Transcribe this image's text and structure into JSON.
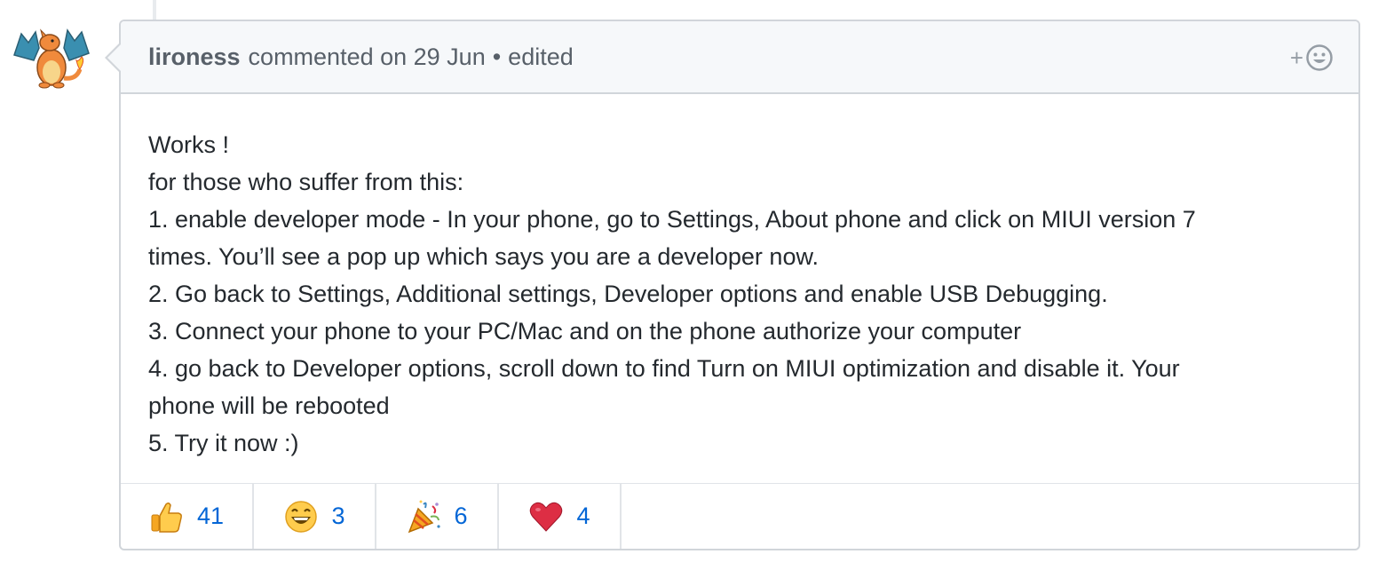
{
  "comment": {
    "author": "lironess",
    "action": "commented on 29 Jun",
    "separator": "•",
    "edited": "edited",
    "add_reaction_plus": "+",
    "body_lines": [
      "Works !",
      "for those who suffer from this:",
      "1. enable developer mode - In your phone, go to Settings, About phone and click on MIUI version 7",
      "times. You’ll see a pop up which says you are a developer now.",
      "2. Go back to Settings, Additional settings, Developer options and enable USB Debugging.",
      "3. Connect your phone to your PC/Mac and on the phone authorize your computer",
      "4. go back to Developer options, scroll down to find Turn on MIUI optimization and disable it. Your",
      "phone will be rebooted",
      "5. Try it now :)"
    ],
    "reactions": [
      {
        "emoji": "thumbs-up-icon",
        "count": "41"
      },
      {
        "emoji": "smile-icon",
        "count": "3"
      },
      {
        "emoji": "party-popper-icon",
        "count": "6"
      },
      {
        "emoji": "heart-icon",
        "count": "4"
      }
    ]
  },
  "colors": {
    "border": "#d1d5da",
    "header_bg": "#f6f8fa",
    "link_blue": "#0366d6",
    "muted_text": "#586069"
  }
}
